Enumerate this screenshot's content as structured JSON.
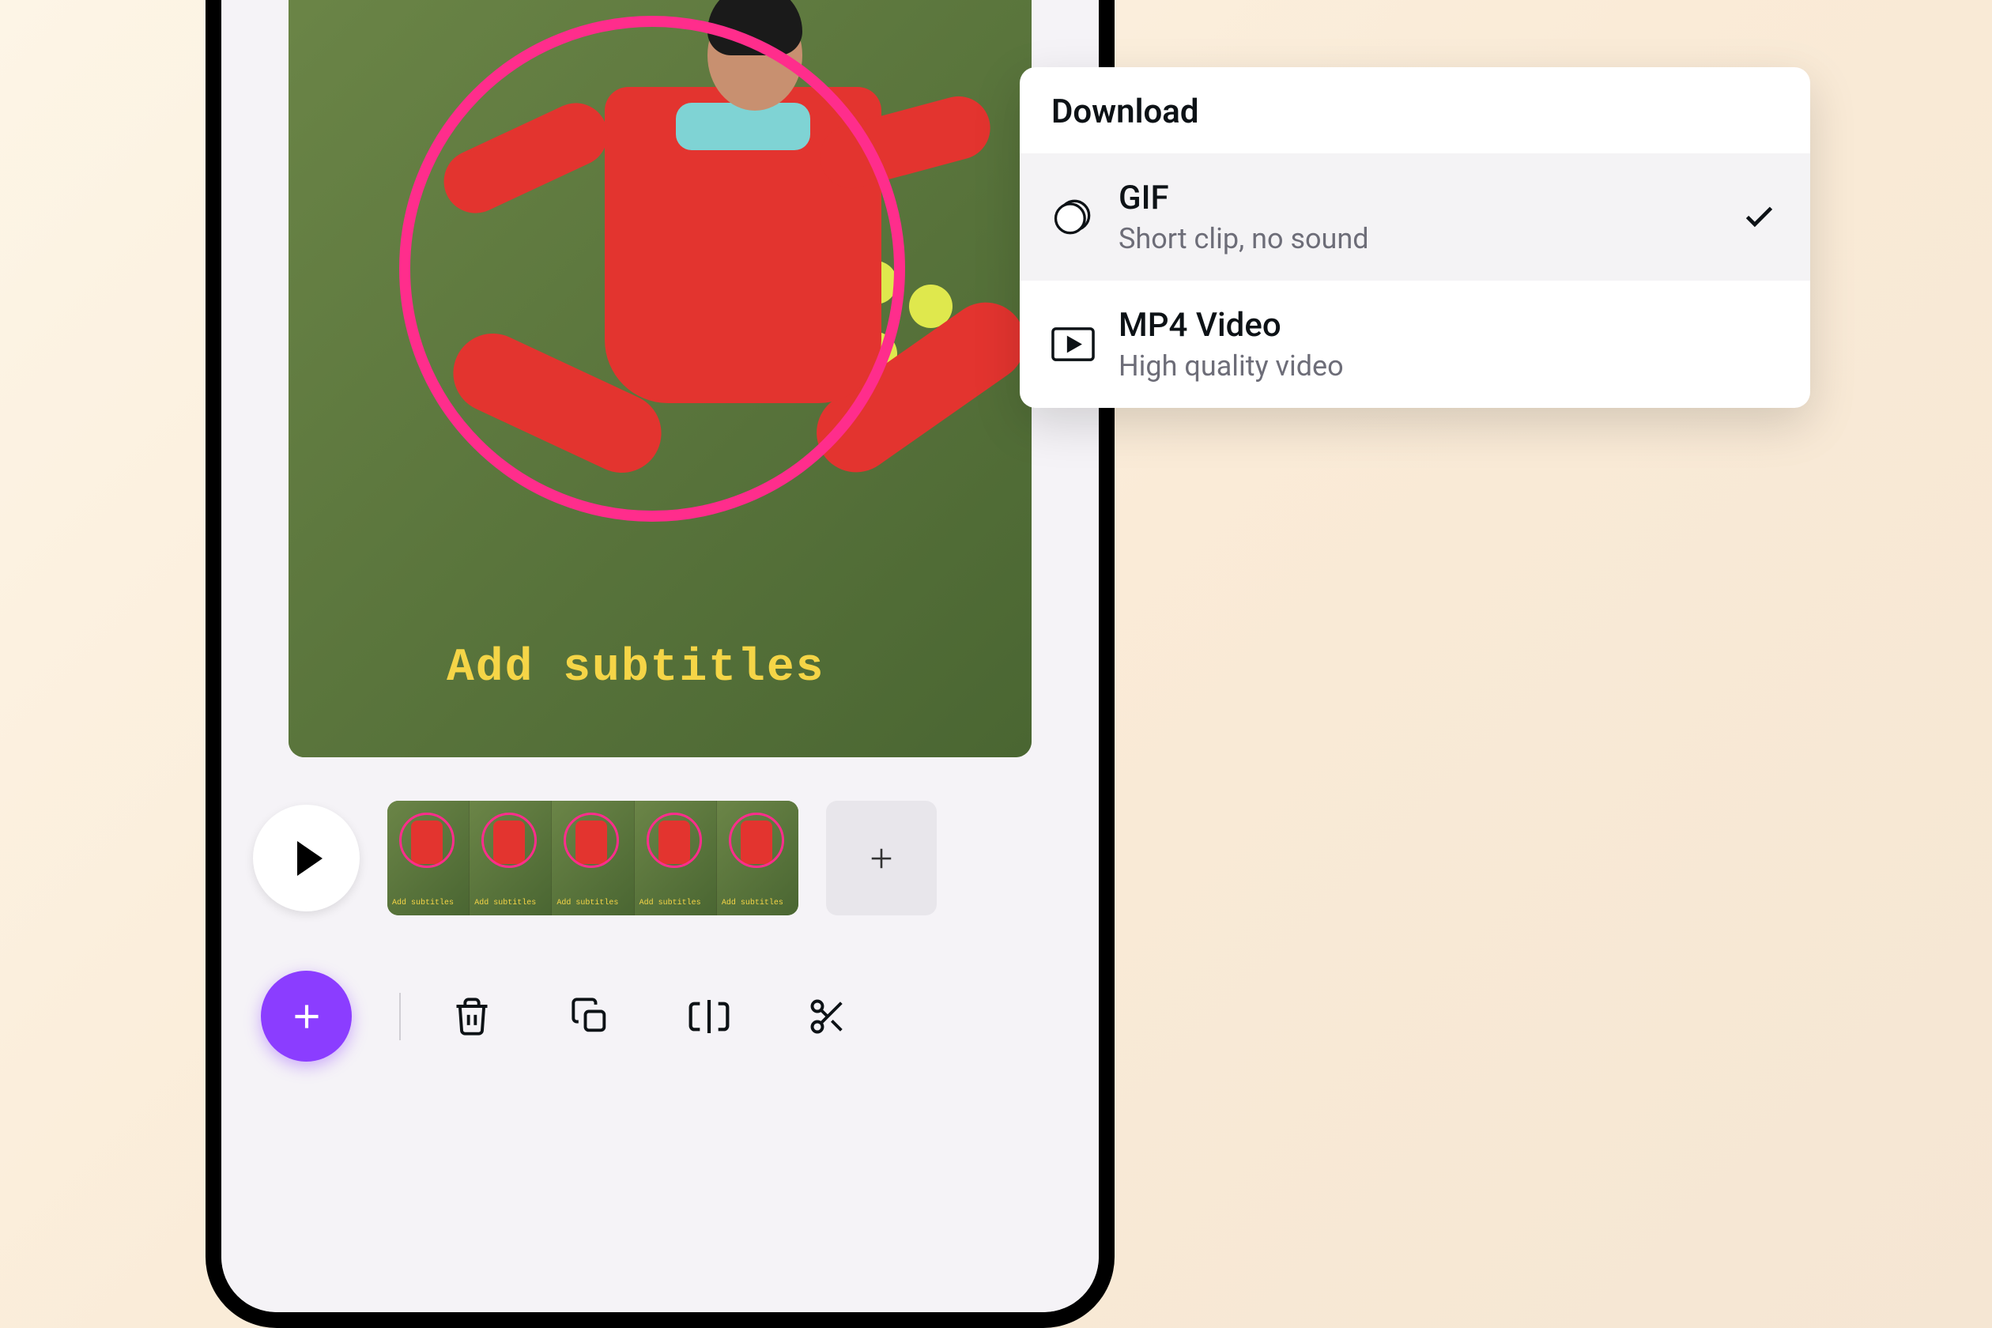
{
  "preview": {
    "subtitle_overlay": "Add subtitles",
    "thumb_label": "Add subtitles"
  },
  "download_popup": {
    "title": "Download",
    "options": [
      {
        "title": "GIF",
        "description": "Short clip, no sound",
        "selected": true
      },
      {
        "title": "MP4 Video",
        "description": "High quality video",
        "selected": false
      }
    ]
  },
  "colors": {
    "accent": "#8b3dff",
    "subtitle": "#f5d547",
    "hoop": "#ff2d8c"
  }
}
